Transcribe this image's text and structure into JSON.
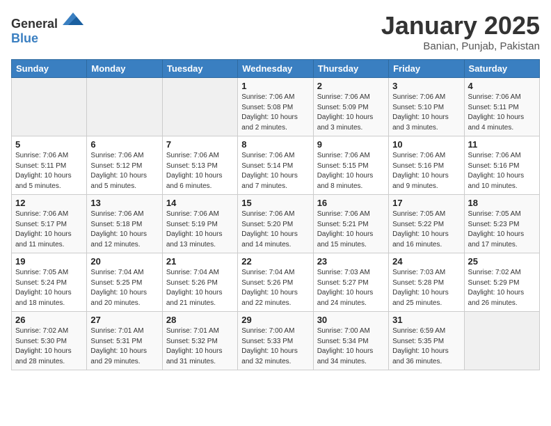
{
  "header": {
    "logo_general": "General",
    "logo_blue": "Blue",
    "title": "January 2025",
    "subtitle": "Banian, Punjab, Pakistan"
  },
  "weekdays": [
    "Sunday",
    "Monday",
    "Tuesday",
    "Wednesday",
    "Thursday",
    "Friday",
    "Saturday"
  ],
  "weeks": [
    [
      {
        "day": "",
        "empty": true
      },
      {
        "day": "",
        "empty": true
      },
      {
        "day": "",
        "empty": true
      },
      {
        "day": "1",
        "sunrise": "7:06 AM",
        "sunset": "5:08 PM",
        "daylight": "10 hours and 2 minutes."
      },
      {
        "day": "2",
        "sunrise": "7:06 AM",
        "sunset": "5:09 PM",
        "daylight": "10 hours and 3 minutes."
      },
      {
        "day": "3",
        "sunrise": "7:06 AM",
        "sunset": "5:10 PM",
        "daylight": "10 hours and 3 minutes."
      },
      {
        "day": "4",
        "sunrise": "7:06 AM",
        "sunset": "5:11 PM",
        "daylight": "10 hours and 4 minutes."
      }
    ],
    [
      {
        "day": "5",
        "sunrise": "7:06 AM",
        "sunset": "5:11 PM",
        "daylight": "10 hours and 5 minutes."
      },
      {
        "day": "6",
        "sunrise": "7:06 AM",
        "sunset": "5:12 PM",
        "daylight": "10 hours and 5 minutes."
      },
      {
        "day": "7",
        "sunrise": "7:06 AM",
        "sunset": "5:13 PM",
        "daylight": "10 hours and 6 minutes."
      },
      {
        "day": "8",
        "sunrise": "7:06 AM",
        "sunset": "5:14 PM",
        "daylight": "10 hours and 7 minutes."
      },
      {
        "day": "9",
        "sunrise": "7:06 AM",
        "sunset": "5:15 PM",
        "daylight": "10 hours and 8 minutes."
      },
      {
        "day": "10",
        "sunrise": "7:06 AM",
        "sunset": "5:16 PM",
        "daylight": "10 hours and 9 minutes."
      },
      {
        "day": "11",
        "sunrise": "7:06 AM",
        "sunset": "5:16 PM",
        "daylight": "10 hours and 10 minutes."
      }
    ],
    [
      {
        "day": "12",
        "sunrise": "7:06 AM",
        "sunset": "5:17 PM",
        "daylight": "10 hours and 11 minutes."
      },
      {
        "day": "13",
        "sunrise": "7:06 AM",
        "sunset": "5:18 PM",
        "daylight": "10 hours and 12 minutes."
      },
      {
        "day": "14",
        "sunrise": "7:06 AM",
        "sunset": "5:19 PM",
        "daylight": "10 hours and 13 minutes."
      },
      {
        "day": "15",
        "sunrise": "7:06 AM",
        "sunset": "5:20 PM",
        "daylight": "10 hours and 14 minutes."
      },
      {
        "day": "16",
        "sunrise": "7:06 AM",
        "sunset": "5:21 PM",
        "daylight": "10 hours and 15 minutes."
      },
      {
        "day": "17",
        "sunrise": "7:05 AM",
        "sunset": "5:22 PM",
        "daylight": "10 hours and 16 minutes."
      },
      {
        "day": "18",
        "sunrise": "7:05 AM",
        "sunset": "5:23 PM",
        "daylight": "10 hours and 17 minutes."
      }
    ],
    [
      {
        "day": "19",
        "sunrise": "7:05 AM",
        "sunset": "5:24 PM",
        "daylight": "10 hours and 18 minutes."
      },
      {
        "day": "20",
        "sunrise": "7:04 AM",
        "sunset": "5:25 PM",
        "daylight": "10 hours and 20 minutes."
      },
      {
        "day": "21",
        "sunrise": "7:04 AM",
        "sunset": "5:26 PM",
        "daylight": "10 hours and 21 minutes."
      },
      {
        "day": "22",
        "sunrise": "7:04 AM",
        "sunset": "5:26 PM",
        "daylight": "10 hours and 22 minutes."
      },
      {
        "day": "23",
        "sunrise": "7:03 AM",
        "sunset": "5:27 PM",
        "daylight": "10 hours and 24 minutes."
      },
      {
        "day": "24",
        "sunrise": "7:03 AM",
        "sunset": "5:28 PM",
        "daylight": "10 hours and 25 minutes."
      },
      {
        "day": "25",
        "sunrise": "7:02 AM",
        "sunset": "5:29 PM",
        "daylight": "10 hours and 26 minutes."
      }
    ],
    [
      {
        "day": "26",
        "sunrise": "7:02 AM",
        "sunset": "5:30 PM",
        "daylight": "10 hours and 28 minutes."
      },
      {
        "day": "27",
        "sunrise": "7:01 AM",
        "sunset": "5:31 PM",
        "daylight": "10 hours and 29 minutes."
      },
      {
        "day": "28",
        "sunrise": "7:01 AM",
        "sunset": "5:32 PM",
        "daylight": "10 hours and 31 minutes."
      },
      {
        "day": "29",
        "sunrise": "7:00 AM",
        "sunset": "5:33 PM",
        "daylight": "10 hours and 32 minutes."
      },
      {
        "day": "30",
        "sunrise": "7:00 AM",
        "sunset": "5:34 PM",
        "daylight": "10 hours and 34 minutes."
      },
      {
        "day": "31",
        "sunrise": "6:59 AM",
        "sunset": "5:35 PM",
        "daylight": "10 hours and 36 minutes."
      },
      {
        "day": "",
        "empty": true
      }
    ]
  ],
  "labels": {
    "sunrise": "Sunrise:",
    "sunset": "Sunset:",
    "daylight": "Daylight:"
  }
}
